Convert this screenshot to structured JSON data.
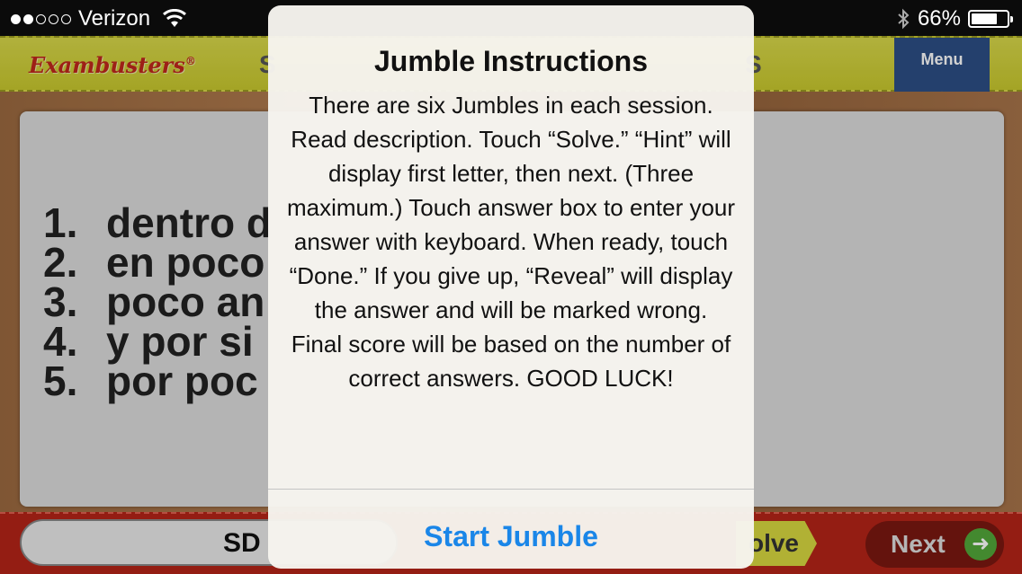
{
  "status_bar": {
    "carrier": "Verizon",
    "signal_bars_filled": 2,
    "signal_bars_total": 5,
    "battery_percent": "66%"
  },
  "header": {
    "logo_text": "Exambusters",
    "logo_mark": "®",
    "title_left_partial": "S",
    "title_right_partial": "S",
    "menu_label": "Menu"
  },
  "list": {
    "items": [
      {
        "number": "1.",
        "text": "dentro d"
      },
      {
        "number": "2.",
        "text": "en poco"
      },
      {
        "number": "3.",
        "text": "poco an"
      },
      {
        "number": "4.",
        "text": "y por si"
      },
      {
        "number": "5.",
        "text": "por poc"
      }
    ]
  },
  "bottom": {
    "answer_text": "SD",
    "solve_label": "olve",
    "next_label": "Next"
  },
  "alert": {
    "title": "Jumble Instructions",
    "body": "There are six Jumbles in each session. Read description. Touch “Solve.” “Hint” will display first letter, then next. (Three maximum.) Touch answer box to enter your answer with keyboard. When ready, touch “Done.” If you give up, “Reveal” will display the answer and will be marked wrong. Final score will be based on the number of correct answers. GOOD LUCK!",
    "button_label": "Start Jumble"
  },
  "colors": {
    "alert_button": "#1a86e8",
    "header_yellow": "#d8d84a",
    "bottom_red": "#b52418",
    "menu_blue": "#2c4f86"
  }
}
